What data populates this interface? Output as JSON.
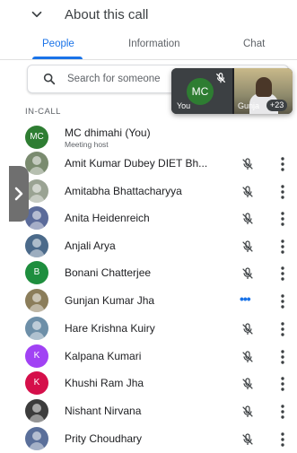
{
  "header": {
    "title": "About this call"
  },
  "tabs": [
    {
      "label": "People",
      "active": true
    },
    {
      "label": "Information",
      "active": false
    },
    {
      "label": "Chat",
      "active": false
    }
  ],
  "search": {
    "placeholder": "Search for someone"
  },
  "section_label": "IN-CALL",
  "pip": {
    "self_initials": "MC",
    "self_label": "You",
    "other_name": "Gunja",
    "extra_count": "+23"
  },
  "participants": [
    {
      "name": "MC dhimahi (You)",
      "subtitle": "Meeting host",
      "initials": "MC",
      "avatar_color": "#2e7d32",
      "avatar_type": "initials",
      "muted": false
    },
    {
      "name": "Amit Kumar Dubey DIET Bh...",
      "initials": "",
      "avatar_color": "#7a8b6f",
      "avatar_type": "photo",
      "muted": true
    },
    {
      "name": "Amitabha Bhattacharyya",
      "initials": "",
      "avatar_color": "#9aa393",
      "avatar_type": "photo",
      "muted": true
    },
    {
      "name": "Anita Heidenreich",
      "initials": "",
      "avatar_color": "#5b6b9a",
      "avatar_type": "photo",
      "muted": true
    },
    {
      "name": "Anjali Arya",
      "initials": "",
      "avatar_color": "#4b6a8a",
      "avatar_type": "photo",
      "muted": true
    },
    {
      "name": "Bonani Chatterjee",
      "initials": "B",
      "avatar_color": "#1e8e3e",
      "avatar_type": "initials",
      "muted": true
    },
    {
      "name": "Gunjan Kumar Jha",
      "initials": "",
      "avatar_color": "#8b7d5a",
      "avatar_type": "photo",
      "speaking": true
    },
    {
      "name": "Hare Krishna Kuiry",
      "initials": "",
      "avatar_color": "#6d8fa8",
      "avatar_type": "photo",
      "muted": true
    },
    {
      "name": "Kalpana Kumari",
      "initials": "K",
      "avatar_color": "#a142f4",
      "avatar_type": "initials",
      "muted": true
    },
    {
      "name": "Khushi Ram Jha",
      "initials": "K",
      "avatar_color": "#d50f4a",
      "avatar_type": "initials",
      "muted": true
    },
    {
      "name": "Nishant Nirvana",
      "initials": "",
      "avatar_color": "#3c3c3c",
      "avatar_type": "photo",
      "muted": true
    },
    {
      "name": "Prity Choudhary",
      "initials": "",
      "avatar_color": "#5a6f9a",
      "avatar_type": "photo",
      "muted": true
    }
  ]
}
